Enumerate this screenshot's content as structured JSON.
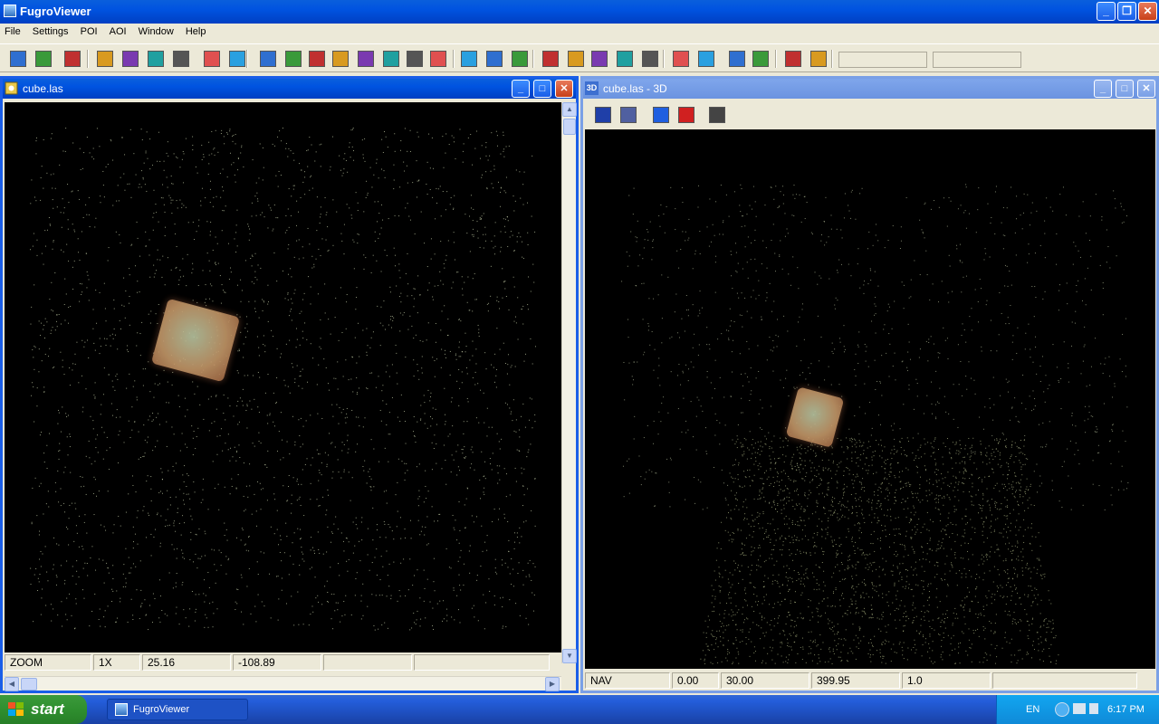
{
  "app": {
    "title": "FugroViewer"
  },
  "menu": [
    "File",
    "Settings",
    "POI",
    "AOI",
    "Window",
    "Help"
  ],
  "toolbar": {
    "icons": [
      "open-file-icon",
      "open-folder-icon",
      "redo-arrow-icon",
      "add-layer-icon",
      "layers-icon",
      "layers-stack-icon",
      "grid-points-icon",
      "contour-icon",
      "tin-surface-icon",
      "elevation-color-icon",
      "intensity-icon",
      "classification-icon",
      "profile-line-icon",
      "slope-icon",
      "aspect-icon",
      "hillshade-icon",
      "color-bars-icon",
      "points-icon",
      "dense-points-icon",
      "fit-extent-icon",
      "pan-hand-icon",
      "zoom-icon",
      "layer-edit-icon",
      "poi-pin-icon",
      "crosshair-icon",
      "help-icon",
      "measure-ruler-icon",
      "draw-line-icon",
      "3d-view-icon",
      "stop-icon",
      "refresh-icon"
    ]
  },
  "windows": {
    "left": {
      "title": "cube.las",
      "status": [
        "ZOOM",
        "1X",
        "25.16",
        "-108.89",
        "",
        ""
      ]
    },
    "right": {
      "title": "cube.las - 3D",
      "icon_text": "3D",
      "toolbar_icons": [
        "north-up-icon",
        "layer-view-icon",
        "z-down-icon",
        "z-up-icon",
        "split-view-icon"
      ],
      "status": [
        "NAV",
        "0.00",
        "30.00",
        "399.95",
        "1.0",
        ""
      ]
    }
  },
  "taskbar": {
    "start_label": "start",
    "task_label": "FugroViewer",
    "lang": "EN",
    "clock": "6:17 PM"
  },
  "colors": {
    "xp_blue": "#0053e0",
    "face": "#ece9d8",
    "point_color": "#cfd8b0",
    "cube_color": "#c39768"
  }
}
